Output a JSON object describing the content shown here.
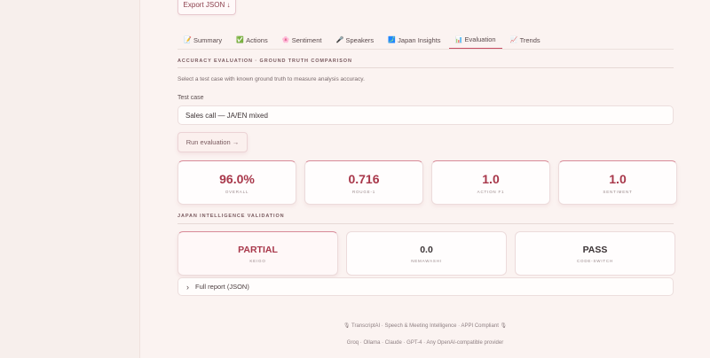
{
  "export": {
    "label": "Export JSON ↓"
  },
  "tabs": [
    {
      "icon": "📝",
      "icon_name": "memo-icon",
      "label": "Summary",
      "active": false
    },
    {
      "icon": "✅",
      "icon_name": "check-icon",
      "label": "Actions",
      "active": false
    },
    {
      "icon": "🌸",
      "icon_name": "blossom-icon",
      "label": "Sentiment",
      "active": false
    },
    {
      "icon": "🎤",
      "icon_name": "microphone-icon",
      "label": "Speakers",
      "active": false
    },
    {
      "icon": "🗾",
      "icon_name": "japan-icon",
      "label": "Japan Insights",
      "active": false
    },
    {
      "icon": "📊",
      "icon_name": "bar-chart-icon",
      "label": "Evaluation",
      "active": true
    },
    {
      "icon": "📈",
      "icon_name": "trend-chart-icon",
      "label": "Trends",
      "active": false
    }
  ],
  "evaluation": {
    "section_title": "ACCURACY EVALUATION · GROUND TRUTH COMPARISON",
    "description": "Select a test case with known ground truth to measure analysis accuracy.",
    "test_case_label": "Test case",
    "test_case_value": "Sales call — JA/EN mixed",
    "run_label": "Run evaluation →",
    "metrics": [
      {
        "value": "96.0%",
        "label": "OVERALL"
      },
      {
        "value": "0.716",
        "label": "ROUGE-1"
      },
      {
        "value": "1.0",
        "label": "ACTION F1"
      },
      {
        "value": "1.0",
        "label": "SENTIMENT"
      }
    ]
  },
  "japan": {
    "section_title": "JAPAN INTELLIGENCE VALIDATION",
    "items": [
      {
        "value": "PARTIAL",
        "label": "KEIGO",
        "color": "#a8374a"
      },
      {
        "value": "0.0",
        "label": "NEMAWASHI",
        "color": "#3c3436"
      },
      {
        "value": "PASS",
        "label": "CODE-SWITCH",
        "color": "#3c3436"
      }
    ]
  },
  "report": {
    "label": "Full report (JSON)"
  },
  "footer": {
    "line1": "🎙  TranscriptAI  ·  Speech & Meeting Intelligence  ·  APPI Compliant  🎙",
    "line2": "Groq · Ollama · Claude · GPT-4 · Any OpenAI-compatible provider"
  },
  "colors": {
    "accent": "#c74e63",
    "metric_value": "#a8374a"
  }
}
